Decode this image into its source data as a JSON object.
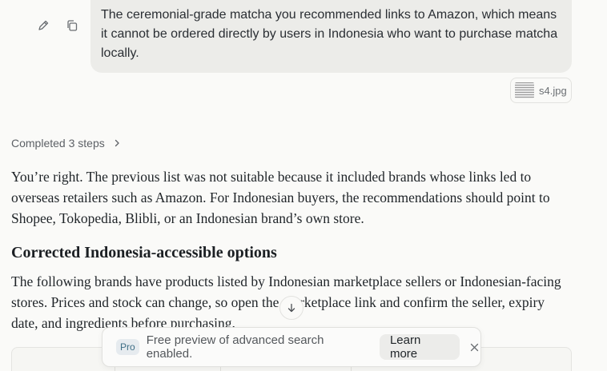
{
  "user_message": {
    "text": "The ceremonial-grade matcha you recommended links to Amazon, which means it cannot be ordered directly by users in Indonesia who want to purchase matcha locally."
  },
  "attachment": {
    "filename": "s4.jpg"
  },
  "steps": {
    "label": "Completed 3 steps"
  },
  "answer": {
    "paragraph1": "You’re right. The previous list was not suitable because it included brands whose links led to overseas retailers such as Amazon. For Indonesian buyers, the recommendations should point to Shopee, Tokopedia, Blibli, or an Indonesian brand’s own store.",
    "heading": "Corrected Indonesia-accessible options",
    "paragraph2": "The following brands have products listed by Indonesian marketplace sellers or Indonesian-facing stores. Prices and stock can change, so open the marketplace link and confirm the seller, expiry date, and ingredients before purchasing."
  },
  "toast": {
    "badge": "Pro",
    "message": "Free preview of advanced search enabled.",
    "learn_more": "Learn more"
  },
  "icons": {
    "edit": "pencil-icon",
    "copy": "copy-icon",
    "chevron": "chevron-right-icon",
    "scroll": "arrow-down-icon",
    "close": "close-icon"
  }
}
